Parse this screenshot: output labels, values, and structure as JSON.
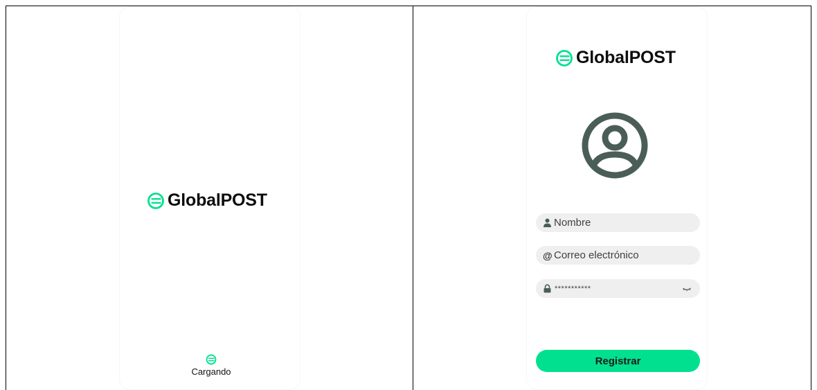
{
  "splash": {
    "brand": "GlobalPOST",
    "loading_label": "Cargando"
  },
  "register": {
    "brand": "GlobalPOST",
    "name_placeholder": "Nombre",
    "email_placeholder": "Correo electrónico",
    "password_value": "***********",
    "submit_label": "Registrar"
  },
  "icons": {
    "brand": "globalpost-logo-icon",
    "avatar": "user-circle-icon",
    "name": "person-icon",
    "email": "at-icon",
    "password": "lock-icon",
    "toggle": "eye-closed-icon"
  },
  "colors": {
    "accent": "#00e08f",
    "avatar": "#4a5e57",
    "field_bg": "#efefef"
  }
}
